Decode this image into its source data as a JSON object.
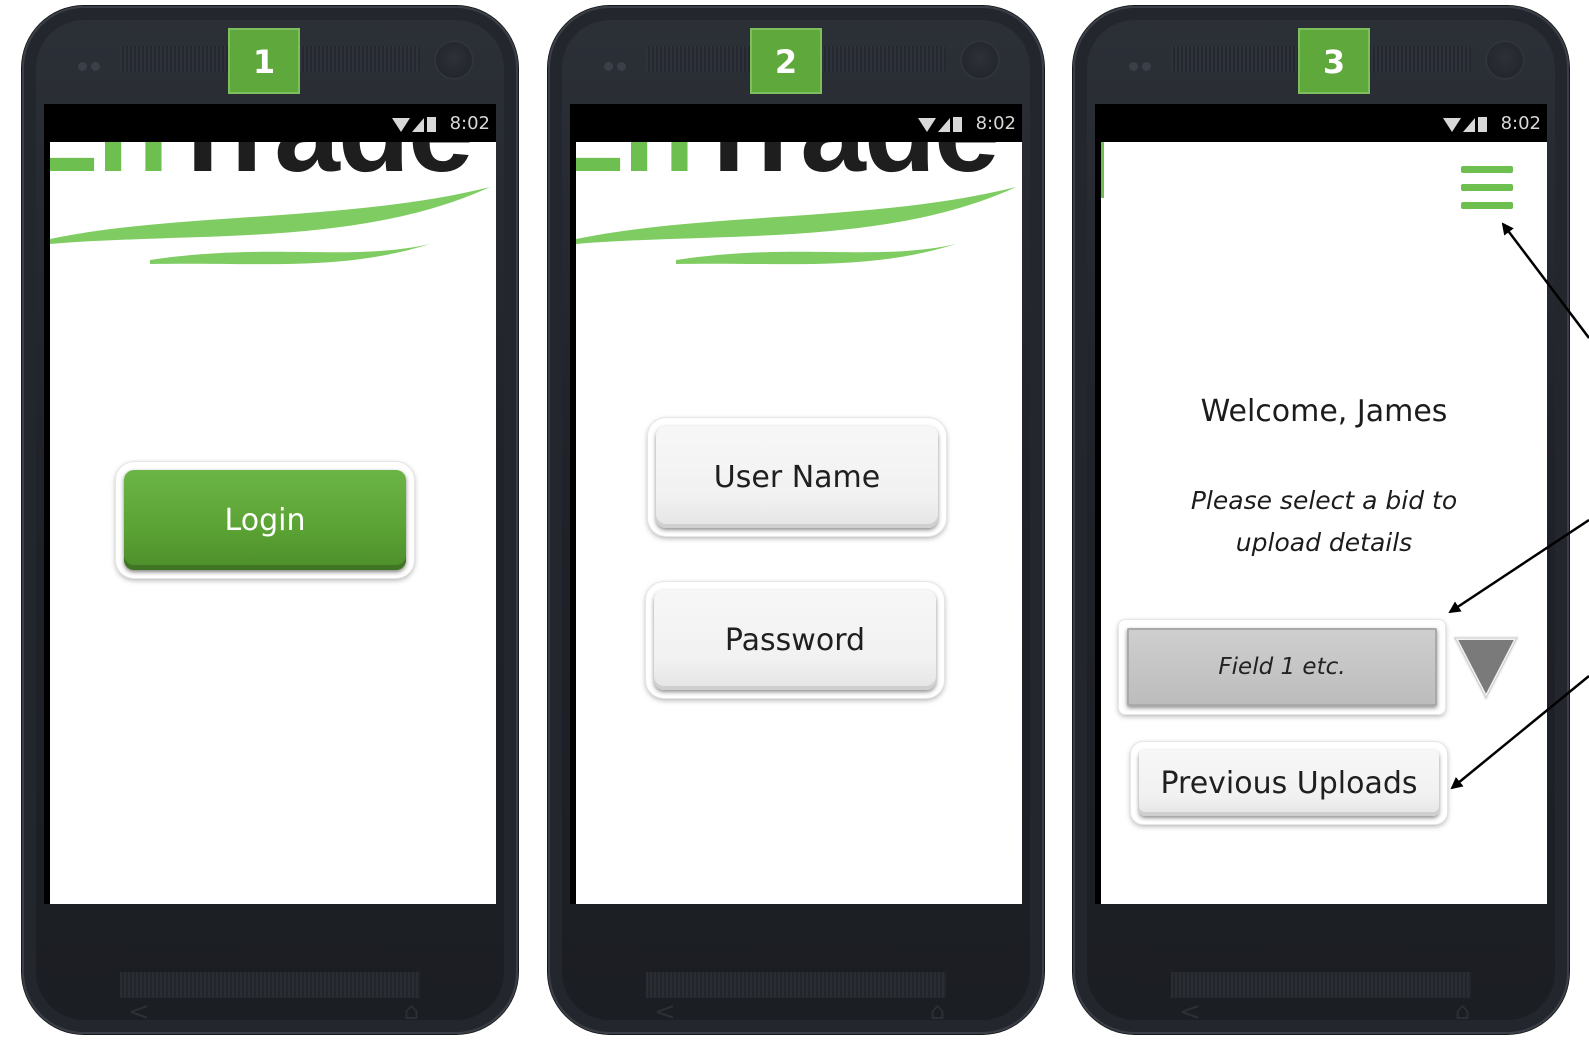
{
  "badges": [
    "1",
    "2",
    "3"
  ],
  "status_bar": {
    "time": "8:02"
  },
  "logo": {
    "part1": "En",
    "part2": "Trade"
  },
  "screen1": {
    "login_label": "Login"
  },
  "screen2": {
    "username_placeholder": "User Name",
    "password_placeholder": "Password"
  },
  "screen3": {
    "welcome": "Welcome, James",
    "instruction": "Please select a bid to upload details",
    "dropdown_value": "Field 1 etc.",
    "previous_uploads_label": "Previous Uploads"
  },
  "nav_icons": [
    "back-icon",
    "home-icon"
  ],
  "colors": {
    "accent_green": "#5fa83b",
    "logo_green": "#6dbf4f",
    "phone_body": "#1f2228"
  }
}
